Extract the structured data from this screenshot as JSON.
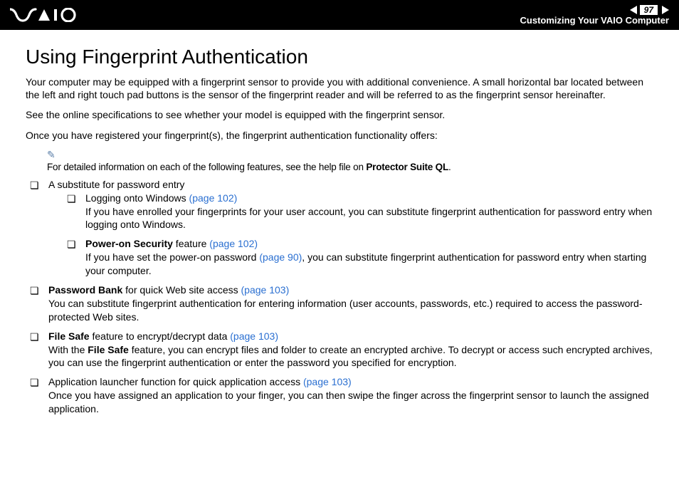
{
  "header": {
    "page_number": "97",
    "section": "Customizing Your VAIO Computer"
  },
  "title": "Using Fingerprint Authentication",
  "paragraphs": {
    "p1": "Your computer may be equipped with a fingerprint sensor to provide you with additional convenience. A small horizontal bar located between the left and right touch pad buttons is the sensor of the fingerprint reader and will be referred to as the fingerprint sensor hereinafter.",
    "p2": "See the online specifications to see whether your model is equipped with the fingerprint sensor.",
    "p3": "Once you have registered your fingerprint(s), the fingerprint authentication functionality offers:"
  },
  "note": {
    "prefix": "For detailed information on each of the following features, see the help file on ",
    "bold": "Protector Suite QL",
    "suffix": "."
  },
  "items": {
    "a1_text": "A substitute for password entry",
    "a1_sub1_lead": "Logging onto Windows ",
    "a1_sub1_link": "(page 102)",
    "a1_sub1_body": "If you have enrolled your fingerprints for your user account, you can substitute fingerprint authentication for password entry when logging onto Windows.",
    "a1_sub2_bold": "Power-on Security",
    "a1_sub2_after": " feature ",
    "a1_sub2_link": "(page 102)",
    "a1_sub2_body_a": "If you have set the power-on password ",
    "a1_sub2_body_link": "(page 90)",
    "a1_sub2_body_b": ", you can substitute fingerprint authentication for password entry when starting your computer.",
    "a2_bold": "Password Bank",
    "a2_after": " for quick Web site access ",
    "a2_link": "(page 103)",
    "a2_body": "You can substitute fingerprint authentication for entering information (user accounts, passwords, etc.) required to access the password-protected Web sites.",
    "a3_bold": "File Safe",
    "a3_after": " feature to encrypt/decrypt data ",
    "a3_link": "(page 103)",
    "a3_body_a": "With the ",
    "a3_body_bold": "File Safe",
    "a3_body_b": " feature, you can encrypt files and folder to create an encrypted archive. To decrypt or access such encrypted archives, you can use the fingerprint authentication or enter the password you specified for encryption.",
    "a4_text": "Application launcher function for quick application access ",
    "a4_link": "(page 103)",
    "a4_body": "Once you have assigned an application to your finger, you can then swipe the finger across the fingerprint sensor to launch the assigned application."
  }
}
